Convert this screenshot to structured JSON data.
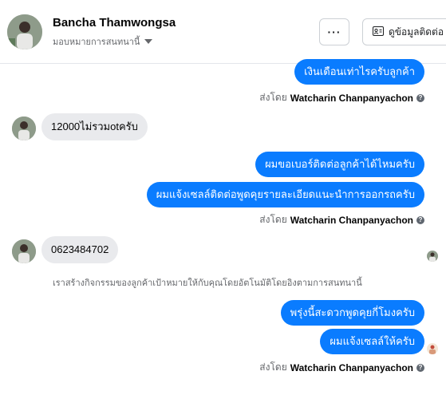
{
  "header": {
    "name": "Bancha Thamwongsa",
    "assign_label": "มอบหมายการสนทนานี้",
    "more_label": "···",
    "contact_label": "ดูข้อมูลติดต่อ"
  },
  "messages": {
    "out1": "เงินเดือนเท่าไรครับลูกค้า",
    "sent_prefix": "ส่งโดย",
    "sender": "Watcharin Chanpanyachon",
    "in1": "12000ไม่รวมotครับ",
    "out2": "ผมขอเบอร์ติดต่อลูกค้าได้ไหมครับ",
    "out3": "ผมแจ้งเซลล์ติดต่อพูดคุยรายละเอียดแนะนำการออกรถครับ",
    "in2": "0623484702",
    "note": "เราสร้างกิจกรรมของลูกค้าเป้าหมายให้กับคุณโดยอัตโนมัติโดยอิงตามการสนทนานี้",
    "out4": "พรุ่งนี้สะดวกพูดคุยกี่โมงครับ",
    "out5": "ผมแจ้งเซลล์ให้ครับ"
  },
  "colors": {
    "accent": "#0a7cff",
    "incoming_bg": "#e9eaed",
    "muted": "#65676b"
  },
  "icons": [
    "chevron-down-icon",
    "more-icon",
    "contact-card-icon",
    "help-icon",
    "seen-avatar-icon"
  ]
}
